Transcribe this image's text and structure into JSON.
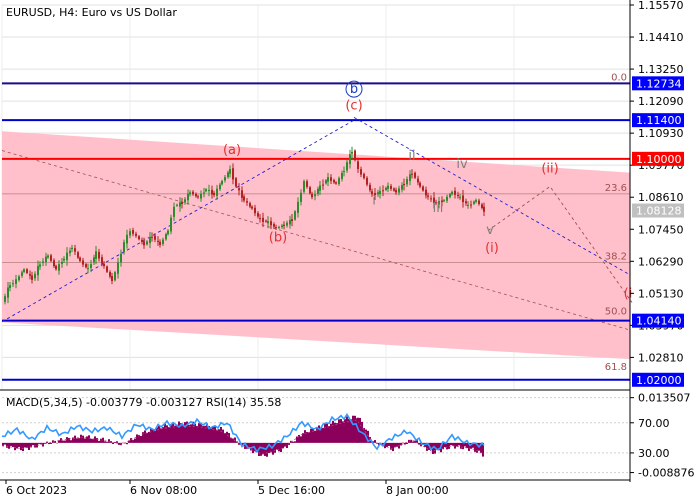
{
  "chart_data": [
    {
      "type": "line",
      "title": "EURUSD, H4:  Euro vs US Dollar",
      "x_ticks": [
        "6 Oct 2023",
        "6 Nov 08:00",
        "5 Dec 16:00",
        "8 Jan 00:00"
      ],
      "ylim": [
        1.0163,
        1.1557
      ],
      "y_ticks": [
        1.1557,
        1.1441,
        1.1325,
        1.1209,
        1.1093,
        1.0977,
        1.0861,
        1.0745,
        1.0629,
        1.0513,
        1.0397,
        1.0281
      ],
      "y_tick_labels": [
        "1.15570",
        "1.14410",
        "1.13250",
        "1.12090",
        "1.10930",
        "1.09770",
        "1.08610",
        "1.07450",
        "1.06290",
        "1.05130",
        "1.03970",
        "1.02810"
      ],
      "grid": true,
      "price_series": [
        {
          "i": 0,
          "v": 1.048
        },
        {
          "i": 8,
          "v": 1.0545
        },
        {
          "i": 14,
          "v": 1.056
        },
        {
          "i": 22,
          "v": 1.06
        },
        {
          "i": 30,
          "v": 1.0565
        },
        {
          "i": 38,
          "v": 1.062
        },
        {
          "i": 46,
          "v": 1.065
        },
        {
          "i": 54,
          "v": 1.06
        },
        {
          "i": 62,
          "v": 1.064
        },
        {
          "i": 70,
          "v": 1.068
        },
        {
          "i": 78,
          "v": 1.063
        },
        {
          "i": 86,
          "v": 1.06
        },
        {
          "i": 94,
          "v": 1.066
        },
        {
          "i": 102,
          "v": 1.061
        },
        {
          "i": 110,
          "v": 1.056
        },
        {
          "i": 116,
          "v": 1.062
        },
        {
          "i": 122,
          "v": 1.07
        },
        {
          "i": 128,
          "v": 1.074
        },
        {
          "i": 134,
          "v": 1.072
        },
        {
          "i": 142,
          "v": 1.069
        },
        {
          "i": 150,
          "v": 1.072
        },
        {
          "i": 158,
          "v": 1.069
        },
        {
          "i": 166,
          "v": 1.074
        },
        {
          "i": 172,
          "v": 1.083
        },
        {
          "i": 180,
          "v": 1.084
        },
        {
          "i": 188,
          "v": 1.088
        },
        {
          "i": 196,
          "v": 1.086
        },
        {
          "i": 204,
          "v": 1.089
        },
        {
          "i": 212,
          "v": 1.087
        },
        {
          "i": 220,
          "v": 1.092
        },
        {
          "i": 228,
          "v": 1.096
        },
        {
          "i": 234,
          "v": 1.09
        },
        {
          "i": 242,
          "v": 1.085
        },
        {
          "i": 250,
          "v": 1.082
        },
        {
          "i": 258,
          "v": 1.078
        },
        {
          "i": 266,
          "v": 1.077
        },
        {
          "i": 274,
          "v": 1.075
        },
        {
          "i": 282,
          "v": 1.076
        },
        {
          "i": 290,
          "v": 1.078
        },
        {
          "i": 296,
          "v": 1.084
        },
        {
          "i": 302,
          "v": 1.092
        },
        {
          "i": 310,
          "v": 1.086
        },
        {
          "i": 318,
          "v": 1.09
        },
        {
          "i": 326,
          "v": 1.093
        },
        {
          "i": 334,
          "v": 1.091
        },
        {
          "i": 342,
          "v": 1.096
        },
        {
          "i": 350,
          "v": 1.103
        },
        {
          "i": 356,
          "v": 1.096
        },
        {
          "i": 362,
          "v": 1.093
        },
        {
          "i": 370,
          "v": 1.087
        },
        {
          "i": 378,
          "v": 1.088
        },
        {
          "i": 386,
          "v": 1.09
        },
        {
          "i": 394,
          "v": 1.088
        },
        {
          "i": 402,
          "v": 1.091
        },
        {
          "i": 410,
          "v": 1.095
        },
        {
          "i": 418,
          "v": 1.09
        },
        {
          "i": 426,
          "v": 1.086
        },
        {
          "i": 434,
          "v": 1.084
        },
        {
          "i": 442,
          "v": 1.085
        },
        {
          "i": 450,
          "v": 1.088
        },
        {
          "i": 458,
          "v": 1.086
        },
        {
          "i": 466,
          "v": 1.083
        },
        {
          "i": 474,
          "v": 1.085
        },
        {
          "i": 482,
          "v": 1.0812
        }
      ],
      "price_labels": [
        {
          "text": "1.12734",
          "v": 1.12734,
          "color": "#0000ff"
        },
        {
          "text": "1.11400",
          "v": 1.114,
          "color": "#0000ff"
        },
        {
          "text": "1.10000",
          "v": 1.1,
          "color": "#ff0000"
        },
        {
          "text": "1.08128",
          "v": 1.08128,
          "color": "#c0c0c0"
        },
        {
          "text": "1.04140",
          "v": 1.0414,
          "color": "#0000ff"
        },
        {
          "text": "1.02000",
          "v": 1.02,
          "color": "#0000ff"
        }
      ],
      "horizontal_lines": [
        {
          "v": 1.12734,
          "color": "#1a0a8c"
        },
        {
          "v": 1.114,
          "color": "#0000cc"
        },
        {
          "v": 1.1,
          "color": "#ff0000"
        },
        {
          "v": 1.0414,
          "color": "#0000cc"
        },
        {
          "v": 1.02,
          "color": "#0000cc"
        }
      ],
      "fibonacci": [
        {
          "text": "0.0",
          "v": 1.1273
        },
        {
          "text": "23.6",
          "v": 1.0873
        },
        {
          "text": "38.2",
          "v": 1.0625
        },
        {
          "text": "50.0",
          "v": 1.0425
        },
        {
          "text": "61.8",
          "v": 1.0225
        }
      ],
      "wave_labels": [
        {
          "text": "(a)",
          "i": 230,
          "v": 1.1018,
          "color": "#e03030"
        },
        {
          "text": "(b)",
          "i": 276,
          "v": 1.07,
          "color": "#e03030"
        },
        {
          "text": "(c)",
          "i": 352,
          "v": 1.1178,
          "color": "#e03030"
        },
        {
          "text": "b",
          "i": 352,
          "v": 1.1238,
          "color": "#1a3cc8",
          "circled": true
        },
        {
          "text": "i",
          "i": 372,
          "v": 1.0835,
          "color": "#808080"
        },
        {
          "text": "ii",
          "i": 410,
          "v": 1.0997,
          "color": "#808080"
        },
        {
          "text": "iii",
          "i": 436,
          "v": 1.0808,
          "color": "#808080"
        },
        {
          "text": "iv",
          "i": 460,
          "v": 1.0967,
          "color": "#808080"
        },
        {
          "text": "v",
          "i": 488,
          "v": 1.0727,
          "color": "#808080"
        },
        {
          "text": "(i)",
          "i": 490,
          "v": 1.0662,
          "color": "#e03030"
        },
        {
          "text": "(ii)",
          "i": 548,
          "v": 1.095,
          "color": "#e03030"
        },
        {
          "text": "(i",
          "i": 626,
          "v": 1.0498,
          "color": "#e03030"
        }
      ],
      "projection": [
        {
          "i": 486,
          "v": 1.074
        },
        {
          "i": 548,
          "v": 1.09
        },
        {
          "i": 630,
          "v": 1.048
        }
      ]
    },
    {
      "type": "line",
      "title": "MACD(5,34,5) -0.003779 -0.003127 RSI(14) 35.58",
      "ylim": [
        -0.0105,
        0.0152
      ],
      "y_tick_labels": [
        "0.013507",
        "70.00",
        "30.00",
        "-0.008876"
      ],
      "y_tick_values": [
        0.013507,
        0.006,
        -0.003,
        -0.008876
      ],
      "macd_series": [
        {
          "i": 0,
          "v": -0.001
        },
        {
          "i": 20,
          "v": -0.002
        },
        {
          "i": 40,
          "v": -0.0005
        },
        {
          "i": 60,
          "v": 0.001
        },
        {
          "i": 80,
          "v": 0.002
        },
        {
          "i": 100,
          "v": 0.001
        },
        {
          "i": 120,
          "v": -0.0005
        },
        {
          "i": 140,
          "v": 0.003
        },
        {
          "i": 160,
          "v": 0.005
        },
        {
          "i": 180,
          "v": 0.006
        },
        {
          "i": 200,
          "v": 0.0055
        },
        {
          "i": 220,
          "v": 0.004
        },
        {
          "i": 240,
          "v": -0.001
        },
        {
          "i": 260,
          "v": -0.004
        },
        {
          "i": 280,
          "v": -0.002
        },
        {
          "i": 300,
          "v": 0.003
        },
        {
          "i": 320,
          "v": 0.005
        },
        {
          "i": 340,
          "v": 0.007
        },
        {
          "i": 355,
          "v": 0.008
        },
        {
          "i": 370,
          "v": 0.0005
        },
        {
          "i": 390,
          "v": -0.002
        },
        {
          "i": 410,
          "v": 0.001
        },
        {
          "i": 430,
          "v": -0.003
        },
        {
          "i": 450,
          "v": -0.001
        },
        {
          "i": 470,
          "v": -0.002
        },
        {
          "i": 482,
          "v": -0.0038
        }
      ],
      "rsi_series": [
        {
          "i": 0,
          "v": 0.002
        },
        {
          "i": 15,
          "v": 0.004
        },
        {
          "i": 30,
          "v": 0.001
        },
        {
          "i": 45,
          "v": 0.0045
        },
        {
          "i": 60,
          "v": 0.0025
        },
        {
          "i": 75,
          "v": 0.005
        },
        {
          "i": 90,
          "v": 0.0035
        },
        {
          "i": 105,
          "v": 0.0045
        },
        {
          "i": 120,
          "v": 0.002
        },
        {
          "i": 135,
          "v": 0.0055
        },
        {
          "i": 150,
          "v": 0.004
        },
        {
          "i": 165,
          "v": 0.006
        },
        {
          "i": 180,
          "v": 0.005
        },
        {
          "i": 195,
          "v": 0.0065
        },
        {
          "i": 210,
          "v": 0.0045
        },
        {
          "i": 225,
          "v": 0.006
        },
        {
          "i": 240,
          "v": -0.0005
        },
        {
          "i": 255,
          "v": -0.002
        },
        {
          "i": 270,
          "v": -0.001
        },
        {
          "i": 285,
          "v": 0.002
        },
        {
          "i": 300,
          "v": 0.006
        },
        {
          "i": 315,
          "v": 0.004
        },
        {
          "i": 330,
          "v": 0.007
        },
        {
          "i": 345,
          "v": 0.008
        },
        {
          "i": 360,
          "v": 0.003
        },
        {
          "i": 375,
          "v": -0.0015
        },
        {
          "i": 390,
          "v": 0.0015
        },
        {
          "i": 405,
          "v": 0.0035
        },
        {
          "i": 420,
          "v": 0.0
        },
        {
          "i": 435,
          "v": -0.002
        },
        {
          "i": 450,
          "v": 0.002
        },
        {
          "i": 465,
          "v": 0.0
        },
        {
          "i": 482,
          "v": -0.0008
        }
      ]
    }
  ]
}
